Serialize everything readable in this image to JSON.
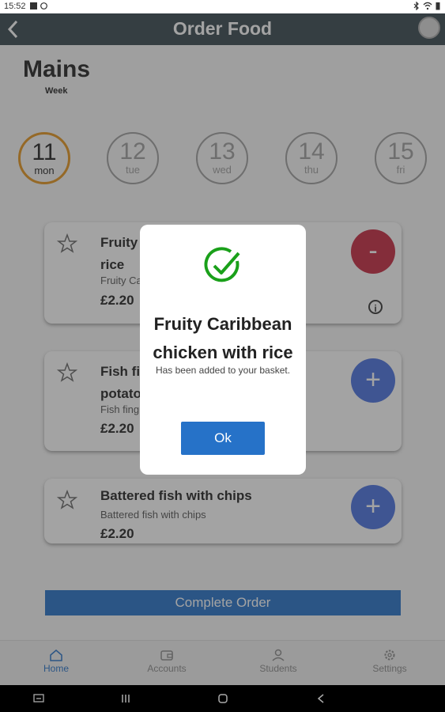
{
  "status_bar": {
    "time": "15:52"
  },
  "app_bar": {
    "title": "Order Food"
  },
  "page": {
    "heading": "Mains",
    "subheading": "Week"
  },
  "days": [
    {
      "num": "11",
      "name": "mon",
      "selected": true
    },
    {
      "num": "12",
      "name": "tue",
      "selected": false
    },
    {
      "num": "13",
      "name": "wed",
      "selected": false
    },
    {
      "num": "14",
      "name": "thu",
      "selected": false
    },
    {
      "num": "15",
      "name": "fri",
      "selected": false
    }
  ],
  "items": [
    {
      "name_line1": "Fruity",
      "name_line2": "rice",
      "desc": "Fruity Ca",
      "price": "£2.20",
      "action": "-"
    },
    {
      "name_line1": "Fish fi",
      "name_line2": "potato",
      "desc": "Fish fing",
      "price": "£2.20",
      "action": "+"
    },
    {
      "name_line1": "Battered fish with chips",
      "desc": "Battered fish with chips",
      "price": "£2.20",
      "action": "+"
    }
  ],
  "complete_order": "Complete Order",
  "bottom_nav": [
    {
      "label": "Home",
      "active": true
    },
    {
      "label": "Accounts",
      "active": false
    },
    {
      "label": "Students",
      "active": false
    },
    {
      "label": "Settings",
      "active": false
    }
  ],
  "dialog": {
    "title_line1": "Fruity Caribbean",
    "title_line2": "chicken with rice",
    "message": "Has been added to your basket.",
    "ok_label": "Ok"
  },
  "colors": {
    "app_bar": "#37474f",
    "accent": "#2672c8",
    "selected_day": "#e6951e",
    "minus": "#c62941",
    "plus": "#4a71e0",
    "check": "#1aa01a"
  }
}
